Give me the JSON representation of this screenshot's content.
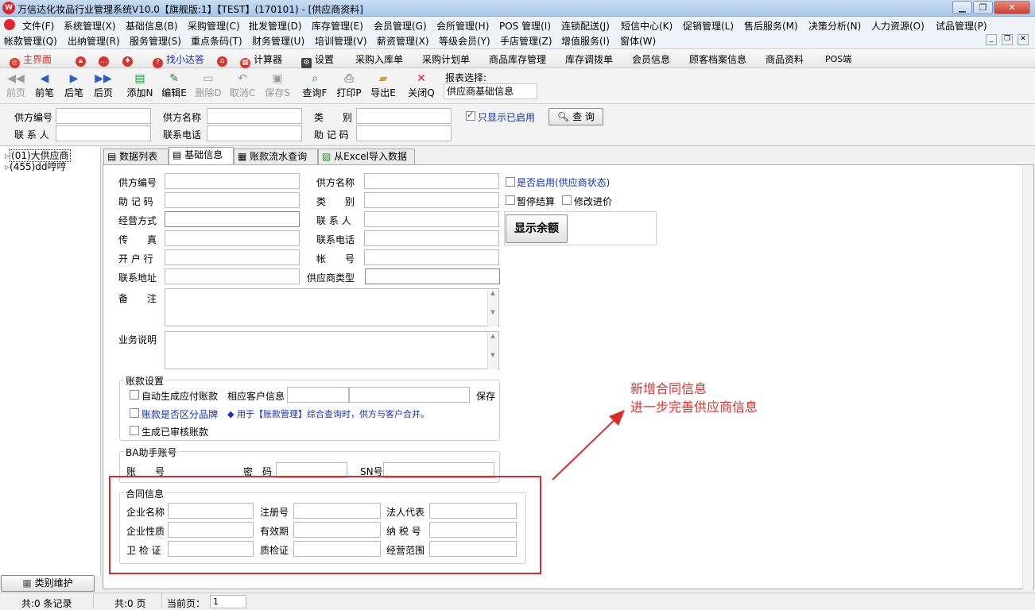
{
  "window": {
    "title": "万信达化妆品行业管理系统V10.0【旗舰版:1】【TEST】(170101) - [供应商资料]"
  },
  "menu": {
    "row1": [
      "文件(F)",
      "系统管理(X)",
      "基础信息(B)",
      "采购管理(C)",
      "批发管理(D)",
      "库存管理(E)",
      "会员管理(G)",
      "会所管理(H)",
      "POS 管理(I)",
      "连锁配送(J)",
      "短信中心(K)",
      "促销管理(L)",
      "售后服务(M)",
      "决策分析(N)",
      "人力资源(O)",
      "试品管理(P)"
    ],
    "row2": [
      "帐款管理(Q)",
      "出纳管理(R)",
      "服务管理(S)",
      "重点条码(T)",
      "财务管理(U)",
      "培训管理(V)",
      "薪资管理(X)",
      "等级会员(Y)",
      "手店管理(Z)",
      "增值服务(I)",
      "窗体(W)"
    ]
  },
  "quickbar": {
    "home": "主界面",
    "xiaoda": "找小达答",
    "calculator": "计算器",
    "settings": "设置",
    "links": [
      "采购入库单",
      "采购计划单",
      "商品库存管理",
      "库存调拨单",
      "会员信息",
      "顾客档案信息",
      "商品资料",
      "POS端"
    ]
  },
  "toolbar": {
    "buttons": [
      "前页",
      "前笔",
      "后笔",
      "后页",
      "添加N",
      "编辑E",
      "删除D",
      "取消C",
      "保存S",
      "查询F",
      "打印P",
      "导出E",
      "关闭Q"
    ],
    "report_label": "报表选择:",
    "report_value": "供应商基础信息"
  },
  "filter": {
    "code": "供方编号",
    "name": "供方名称",
    "category": "类　　别",
    "contact": "联 系 人",
    "phone": "联系电话",
    "mnemonic": "助 记 码",
    "only_enabled": "只显示已启用",
    "query": "查 询"
  },
  "tree": {
    "items": [
      "(01)大供应商",
      "(455)dd哼哼"
    ],
    "category_maint": "类别维护"
  },
  "tabs": [
    "数据列表",
    "基础信息",
    "账款流水查询",
    "从Excel导入数据"
  ],
  "form": {
    "code": "供方编号",
    "name": "供方名称",
    "enabled": "是否启用(供应商状态)",
    "mnemonic": "助 记 码",
    "category": "类　　别",
    "pause": "暂停结算",
    "modify_price": "修改进价",
    "mode": "经营方式",
    "contact": "联 系 人",
    "show_balance": "显示余额",
    "fax": "传　　真",
    "phone": "联系电话",
    "bank": "开 户 行",
    "account": "帐　　号",
    "address": "联系地址",
    "type": "供应商类型",
    "remark": "备　　注",
    "business": "业务说明"
  },
  "account_settings": {
    "title": "账款设置",
    "auto_gen": "自动生成应付账款",
    "related": "相应客户信息",
    "save": "保存",
    "by_brand": "账款是否区分品牌",
    "note": "◆ 用于【账款管理】综合查询时，供方与客户合并。",
    "audited": "生成已审核账款"
  },
  "ba": {
    "title": "BA助手账号",
    "account": "账　　号",
    "password": "密　码",
    "sn": "SN号"
  },
  "contract": {
    "title": "合同信息",
    "company": "企业名称",
    "reg_no": "注册号",
    "legal": "法人代表",
    "nature": "企业性质",
    "valid": "有效期",
    "tax": "纳 税 号",
    "health": "卫 检 证",
    "quality": "质检证",
    "scope": "经营范围"
  },
  "annotation": {
    "line1": "新增合同信息",
    "line2": "进一步完善供应商信息"
  },
  "status": {
    "records": "共:0 条记录",
    "pages": "共:0 页",
    "current_label": "当前页：",
    "current": "1"
  }
}
